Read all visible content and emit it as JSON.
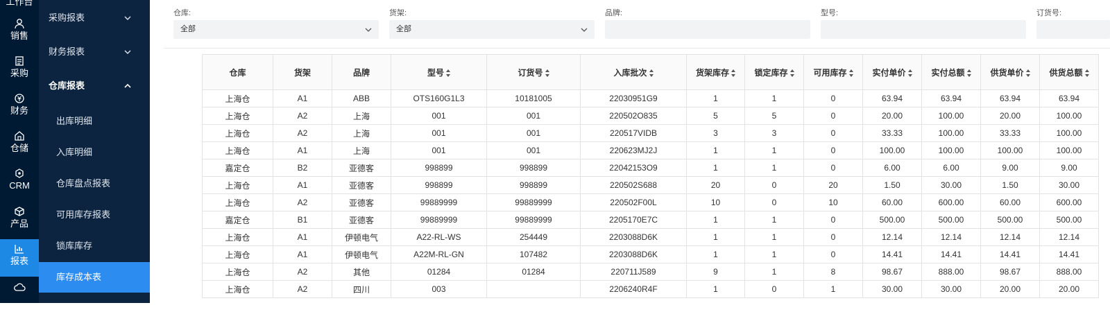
{
  "rail": {
    "top_label": "工作台",
    "items": [
      {
        "label": "销售",
        "icon": "user-icon"
      },
      {
        "label": "采购",
        "icon": "document-icon"
      },
      {
        "label": "财务",
        "icon": "currency-icon"
      },
      {
        "label": "仓储",
        "icon": "warehouse-icon"
      },
      {
        "label": "CRM",
        "icon": "crm-icon"
      },
      {
        "label": "产品",
        "icon": "box-icon"
      },
      {
        "label": "报表",
        "icon": "chart-icon"
      },
      {
        "label": "",
        "icon": "cloud-icon"
      }
    ],
    "active": "报表"
  },
  "submenu": {
    "purchase_report": "采购报表",
    "finance_report": "财务报表",
    "warehouse_report": "仓库报表",
    "children": [
      "出库明细",
      "入库明细",
      "仓库盘点报表",
      "可用库存报表",
      "锁库库存",
      "库存成本表"
    ],
    "selected": "库存成本表"
  },
  "filters": {
    "warehouse": {
      "label": "仓库:",
      "value": "全部"
    },
    "shelf": {
      "label": "货架:",
      "value": "全部"
    },
    "brand": {
      "label": "品牌:",
      "value": ""
    },
    "model": {
      "label": "型号:",
      "value": ""
    },
    "order_no": {
      "label": "订货号:",
      "value": ""
    }
  },
  "table": {
    "headers": [
      "仓库",
      "货架",
      "品牌",
      "型号",
      "订货号",
      "入库批次",
      "货架库存",
      "锁定库存",
      "可用库存",
      "实付单价",
      "实付总额",
      "供货单价",
      "供货总额"
    ],
    "sortable": [
      false,
      false,
      false,
      true,
      true,
      true,
      true,
      true,
      true,
      true,
      true,
      true,
      true
    ],
    "rows": [
      [
        "上海仓",
        "A1",
        "ABB",
        "OTS160G1L3",
        "10181005",
        "22030951G9",
        "1",
        "1",
        "0",
        "63.94",
        "63.94",
        "63.94",
        "63.94"
      ],
      [
        "上海仓",
        "A2",
        "上海",
        "001",
        "001",
        "220502O835",
        "5",
        "5",
        "0",
        "20.00",
        "100.00",
        "20.00",
        "100.00"
      ],
      [
        "上海仓",
        "A2",
        "上海",
        "001",
        "001",
        "220517VIDB",
        "3",
        "3",
        "0",
        "33.33",
        "100.00",
        "33.33",
        "100.00"
      ],
      [
        "上海仓",
        "A1",
        "上海",
        "001",
        "001",
        "220623MJ2J",
        "1",
        "1",
        "0",
        "100.00",
        "100.00",
        "100.00",
        "100.00"
      ],
      [
        "嘉定仓",
        "B2",
        "亚德客",
        "998899",
        "998899",
        "22042153O9",
        "1",
        "1",
        "0",
        "6.00",
        "6.00",
        "9.00",
        "9.00"
      ],
      [
        "上海仓",
        "A1",
        "亚德客",
        "998899",
        "998899",
        "220502S688",
        "20",
        "0",
        "20",
        "1.50",
        "30.00",
        "1.50",
        "30.00"
      ],
      [
        "上海仓",
        "A2",
        "亚德客",
        "99889999",
        "99889999",
        "220502F00L",
        "10",
        "0",
        "10",
        "60.00",
        "600.00",
        "60.00",
        "600.00"
      ],
      [
        "嘉定仓",
        "B1",
        "亚德客",
        "99889999",
        "99889999",
        "2205170E7C",
        "1",
        "1",
        "0",
        "500.00",
        "500.00",
        "500.00",
        "500.00"
      ],
      [
        "上海仓",
        "A1",
        "伊顿电气",
        "A22-RL-WS",
        "254449",
        "2203088D6K",
        "1",
        "1",
        "0",
        "12.14",
        "12.14",
        "12.14",
        "12.14"
      ],
      [
        "上海仓",
        "A1",
        "伊顿电气",
        "A22M-RL-GN",
        "107482",
        "2203088D6K",
        "1",
        "1",
        "0",
        "14.41",
        "14.41",
        "14.41",
        "14.41"
      ],
      [
        "上海仓",
        "A2",
        "其他",
        "01284",
        "01284",
        "220711J589",
        "9",
        "1",
        "8",
        "98.67",
        "888.00",
        "98.67",
        "888.00"
      ],
      [
        "上海仓",
        "A2",
        "四川",
        "003",
        "",
        "2206240R4F",
        "1",
        "0",
        "1",
        "30.00",
        "30.00",
        "20.00",
        "20.00"
      ]
    ]
  },
  "colors": {
    "rail_bg": "#001a33",
    "submenu_bg": "#0d2440",
    "accent": "#1e88e5"
  }
}
